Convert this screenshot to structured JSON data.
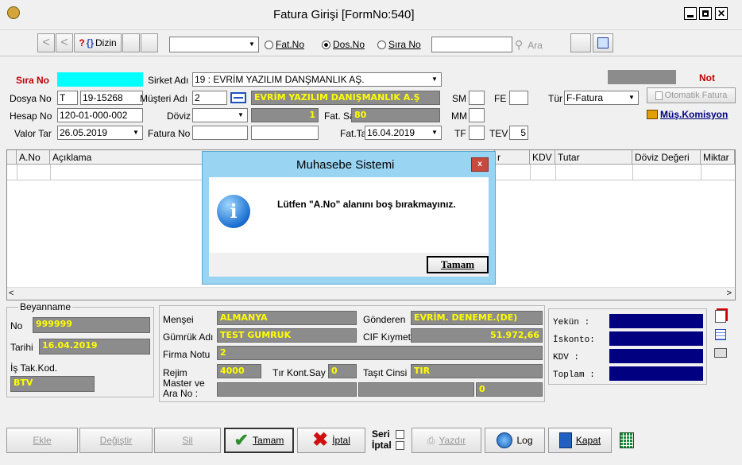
{
  "window": {
    "title": "Fatura Girişi [FormNo:540]"
  },
  "toolbar": {
    "dizin": "Dizin",
    "radio_fatno": "Fat.No",
    "radio_dosno": "Dos.No",
    "radio_sirano": "Sıra No",
    "selected_radio": "Dos.No",
    "ara": "Ara"
  },
  "header": {
    "sira_no_label": "Sıra No",
    "sira_no": "",
    "dosya_no_label": "Dosya No",
    "dosya_no_prefix": "T",
    "dosya_no": "19-15268",
    "hesap_no_label": "Hesap No",
    "hesap_no": "120-01-000-002",
    "valor_tar_label": "Valor Tar",
    "valor_tar": "26.05.2019",
    "sirket_adi_label": "Sirket Adı",
    "sirket_adi": "19 : EVRİM YAZILIM DANŞMANLIK AŞ.",
    "musteri_adi_label": "Müşteri Adı",
    "musteri_no": "2",
    "musteri_adi": "EVRİM YAZILIM DANIŞMANLIK A.Ş",
    "doviz_label": "Döviz",
    "doviz": "",
    "doviz_kur": "1",
    "fatura_no_label": "Fatura No",
    "fatura_no": "",
    "fat_say_label": "Fat. Say",
    "fat_say": "80",
    "fat_tar_label": "Fat.Tar",
    "fat_tar": "16.04.2019",
    "sm_label": "SM",
    "mm_label": "MM",
    "tf_label": "TF",
    "fe_label": "FE",
    "tev_label": "TEV",
    "tev": "5",
    "tur_label": "Tür",
    "tur": "F-Fatura",
    "not_label": "Not",
    "otomatik_fatura": "Otomatik Fatura",
    "mus_komisyon": "Müş.Komisyon"
  },
  "grid": {
    "columns": [
      "A.No",
      "Açıklama",
      "r",
      "KDV",
      "Tutar",
      "Döviz Değeri",
      "Miktar"
    ]
  },
  "dialog": {
    "title": "Muhasebe Sistemi",
    "message": "Lütfen \"A.No\" alanını boş bırakmayınız.",
    "ok": "Tamam"
  },
  "beyanname": {
    "legend": "Beyanname",
    "no_label": "No",
    "no": "999999",
    "tarihi_label": "Tarihi",
    "tarihi": "16.04.2019",
    "is_takip_label": "İş Tak.Kod.",
    "is_takip": "BTV"
  },
  "detail": {
    "mensei_label": "Menşei",
    "mensei": "ALMANYA",
    "gonderen_label": "Gönderen",
    "gonderen": "EVRİM. DENEME.(DE)",
    "gumruk_label": "Gümrük Adı",
    "gumruk": "TEST GUMRUK",
    "cif_label": "CIF Kıymet",
    "cif": "51.972,66",
    "firma_notu_label": "Firma Notu",
    "firma_notu": "2",
    "rejim_label": "Rejim",
    "rejim": "4000",
    "tir_kont_label": "Tır Kont.Say",
    "tir_kont": "0",
    "tasit_label": "Taşıt Cinsi",
    "tasit": "TIR",
    "master_label1": "Master ve",
    "master_label2": "Ara No :",
    "master_no": "0"
  },
  "totals": {
    "yekun": "Yekün   :",
    "iskonto": "İskonto:",
    "kdv": "KDV     :",
    "toplam": "Toplam  :"
  },
  "buttons": {
    "ekle": "Ekle",
    "degistir": "Değiştir",
    "sil": "Sil",
    "tamam": "Tamam",
    "iptal": "İptal",
    "seri": "Seri",
    "iptal2": "İptal",
    "yazdir": "Yazdır",
    "log": "Log",
    "kapat": "Kapat"
  },
  "colors": {
    "yellow": "#ffff00",
    "cyan": "#00ffff",
    "gray": "#8c8c8c",
    "navy": "#000080",
    "dialog_title": "#99d5f2",
    "red": "#c00000"
  }
}
